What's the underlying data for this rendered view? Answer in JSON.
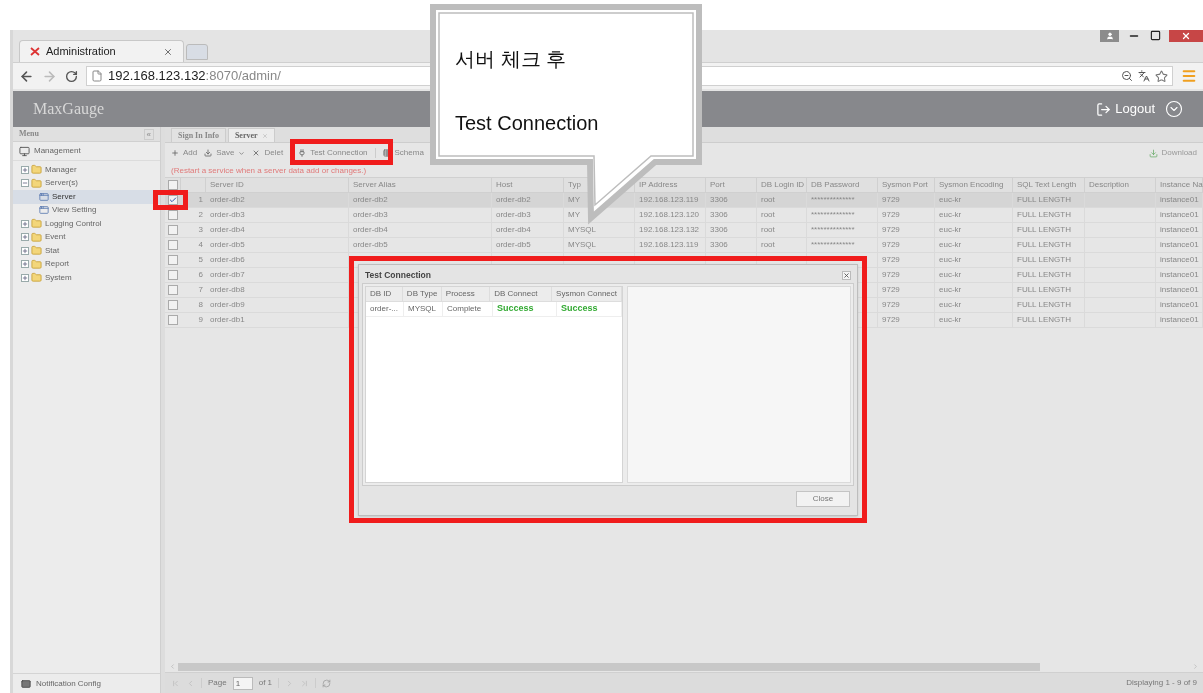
{
  "browser": {
    "tab_title": "Administration",
    "url_host": "192.168.123.132",
    "url_path": ":8070/admin/"
  },
  "app": {
    "logo": "MaxGauge",
    "logout": "Logout"
  },
  "sidebar": {
    "title": "Menu",
    "collapse": "«",
    "section": "Management",
    "tree": [
      {
        "label": "Manager",
        "expanded": false,
        "selected": false
      },
      {
        "label": "Server(s)",
        "expanded": true,
        "selected": false,
        "children": [
          {
            "label": "Server",
            "selected": true
          },
          {
            "label": "View Setting",
            "selected": false
          }
        ]
      },
      {
        "label": "Logging Control",
        "expanded": false,
        "selected": false
      },
      {
        "label": "Event",
        "expanded": false,
        "selected": false
      },
      {
        "label": "Stat",
        "expanded": false,
        "selected": false
      },
      {
        "label": "Report",
        "expanded": false,
        "selected": false
      },
      {
        "label": "System",
        "expanded": false,
        "selected": false
      }
    ],
    "footer": "Notification Config"
  },
  "tabs": [
    {
      "label": "Sign In Info",
      "selected": false,
      "closable": false
    },
    {
      "label": "Server",
      "selected": true,
      "closable": true
    }
  ],
  "toolbar": [
    {
      "kind": "button",
      "label": "Add"
    },
    {
      "kind": "menu",
      "label": "Save"
    },
    {
      "kind": "button",
      "label": "Delet"
    },
    {
      "kind": "button",
      "label": "Test Connection"
    },
    {
      "kind": "button",
      "label": "Schema"
    }
  ],
  "download": "Download",
  "notice": "(Restart a service when a server data add or changes.)",
  "grid": {
    "header_checkbox": {
      "checked": false
    },
    "columns": [
      "Server ID",
      "Server Alias",
      "Host",
      "Typ",
      "IP Address",
      "Port",
      "DB Login ID",
      "DB Password",
      "Sysmon Port",
      "Sysmon Encoding",
      "SQL Text Length",
      "Description",
      "Instance Na"
    ],
    "rows": [
      {
        "number": "1",
        "checked": true,
        "selected": true,
        "cells": [
          "order-db2",
          "order-db2",
          "order-db2",
          "MY",
          "192.168.123.119",
          "3306",
          "root",
          "**************",
          "9729",
          "euc-kr",
          "FULL LENGTH",
          null,
          "instance01"
        ]
      },
      {
        "number": "2",
        "checked": false,
        "selected": false,
        "cells": [
          "order-db3",
          "order-db3",
          "order-db3",
          "MY",
          "192.168.123.120",
          "3306",
          "root",
          "**************",
          "9729",
          "euc-kr",
          "FULL LENGTH",
          null,
          "instance01"
        ]
      },
      {
        "number": "3",
        "checked": false,
        "selected": false,
        "cells": [
          "order-db4",
          "order-db4",
          "order-db4",
          "MYSQL",
          "192.168.123.132",
          "3306",
          "root",
          "**************",
          "9729",
          "euc-kr",
          "FULL LENGTH",
          null,
          "instance01"
        ]
      },
      {
        "number": "4",
        "checked": false,
        "selected": false,
        "cells": [
          "order-db5",
          "order-db5",
          "order-db5",
          "MYSQL",
          "192.168.123.119",
          "3306",
          "root",
          "**************",
          "9729",
          "euc-kr",
          "FULL LENGTH",
          null,
          "instance01"
        ]
      },
      {
        "number": "5",
        "checked": false,
        "selected": false,
        "cells": [
          "order-db6",
          null,
          null,
          null,
          null,
          null,
          null,
          null,
          "9729",
          "euc-kr",
          "FULL LENGTH",
          null,
          "instance01"
        ]
      },
      {
        "number": "6",
        "checked": false,
        "selected": false,
        "cells": [
          "order-db7",
          null,
          null,
          null,
          null,
          null,
          null,
          null,
          "9729",
          "euc-kr",
          "FULL LENGTH",
          null,
          "instance01"
        ]
      },
      {
        "number": "7",
        "checked": false,
        "selected": false,
        "cells": [
          "order-db8",
          null,
          null,
          null,
          null,
          null,
          null,
          null,
          "9729",
          "euc-kr",
          "FULL LENGTH",
          null,
          "instance01"
        ]
      },
      {
        "number": "8",
        "checked": false,
        "selected": false,
        "cells": [
          "order-db9",
          null,
          null,
          null,
          null,
          null,
          null,
          null,
          "9729",
          "euc-kr",
          "FULL LENGTH",
          null,
          "instance01"
        ]
      },
      {
        "number": "9",
        "checked": false,
        "selected": false,
        "cells": [
          "order-db1",
          null,
          null,
          null,
          null,
          null,
          null,
          null,
          "9729",
          "euc-kr",
          "FULL LENGTH",
          null,
          "instance01"
        ]
      }
    ]
  },
  "pager": {
    "page_label": "Page",
    "page": "1",
    "of": "of 1",
    "display": "Displaying 1 - 9 of 9"
  },
  "dialog": {
    "title": "Test Connection",
    "columns": [
      "DB ID",
      "DB Type",
      "Process",
      "DB Connect",
      "Sysmon Connect"
    ],
    "rows": [
      {
        "cells": [
          {
            "text": "order-..."
          },
          {
            "text": "MYSQL"
          },
          {
            "text": "Complete"
          },
          {
            "text": "Success",
            "color": "#33aa33"
          },
          {
            "text": "Success",
            "color": "#33aa33"
          }
        ]
      }
    ],
    "button": "Close"
  },
  "callout": {
    "lines": [
      "서버 체크 후",
      "Test Connection"
    ]
  }
}
